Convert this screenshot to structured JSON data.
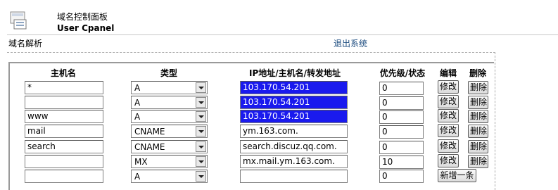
{
  "header": {
    "title_cn": "域名控制面板",
    "title_en": "User Cpanel",
    "logo_icon": "control-panel-icon"
  },
  "section_label": "域名解析",
  "logout_label": "退出系统",
  "table": {
    "headers": {
      "host": "主机名",
      "type": "类型",
      "address": "IP地址/主机名/转发地址",
      "priority": "优先级/状态",
      "edit": "编辑",
      "delete": "删除"
    },
    "rows": [
      {
        "host": "*",
        "type": "A",
        "address": "103.170.54.201",
        "priority": "0",
        "edit": "修改",
        "delete": "删除"
      },
      {
        "host": "",
        "type": "A",
        "address": "103.170.54.201",
        "priority": "0",
        "edit": "修改",
        "delete": "删除"
      },
      {
        "host": "www",
        "type": "A",
        "address": "103.170.54.201",
        "priority": "0",
        "edit": "修改",
        "delete": "删除"
      },
      {
        "host": "mail",
        "type": "CNAME",
        "address": "ym.163.com.",
        "priority": "0",
        "edit": "修改",
        "delete": "删除"
      },
      {
        "host": "search",
        "type": "CNAME",
        "address": "search.discuz.qq.com.",
        "priority": "0",
        "edit": "修改",
        "delete": "删除"
      },
      {
        "host": "",
        "type": "MX",
        "address": "mx.mail.ym.163.com.",
        "priority": "10",
        "edit": "修改",
        "delete": "删除"
      }
    ],
    "new_row": {
      "host": "",
      "type": "A",
      "address": "",
      "priority": "0",
      "add_label": "新增一条"
    }
  }
}
